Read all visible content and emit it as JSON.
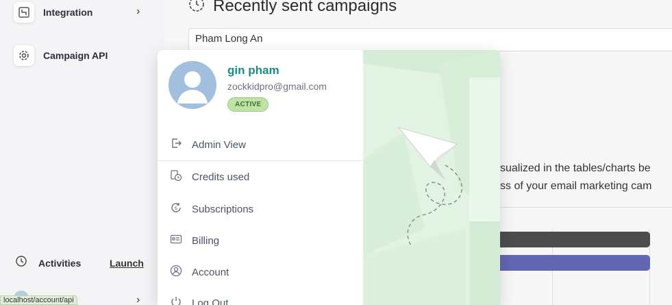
{
  "sidebar": {
    "items": [
      {
        "label": "Integration",
        "icon": "integration-icon"
      },
      {
        "label": "Campaign API",
        "icon": "api-gear-icon"
      }
    ],
    "activities_label": "Activities",
    "launch_label": "Launch",
    "status_url": "localhost/account/api"
  },
  "main": {
    "heading": "Recently sent campaigns",
    "campaign_name": "Pham Long An",
    "desc_line1": "sualized in the tables/charts be",
    "desc_line2": "ss of your email marketing cam"
  },
  "popup": {
    "name": "gin pham",
    "email": "zockkidpro@gmail.com",
    "status": "ACTIVE",
    "menu": [
      {
        "label": "Admin View",
        "icon": "exit-arrow-icon"
      },
      {
        "label": "Credits used",
        "icon": "credits-clock-icon"
      },
      {
        "label": "Subscriptions",
        "icon": "subscriptions-icon"
      },
      {
        "label": "Billing",
        "icon": "billing-card-icon"
      },
      {
        "label": "Account",
        "icon": "account-user-icon"
      },
      {
        "label": "Log Out",
        "icon": "power-icon"
      }
    ]
  },
  "colors": {
    "accent_teal": "#1b8a83",
    "badge_green": "#bfe3a6",
    "bar_dark": "#4d4d4d",
    "bar_purple": "#6167b2"
  }
}
